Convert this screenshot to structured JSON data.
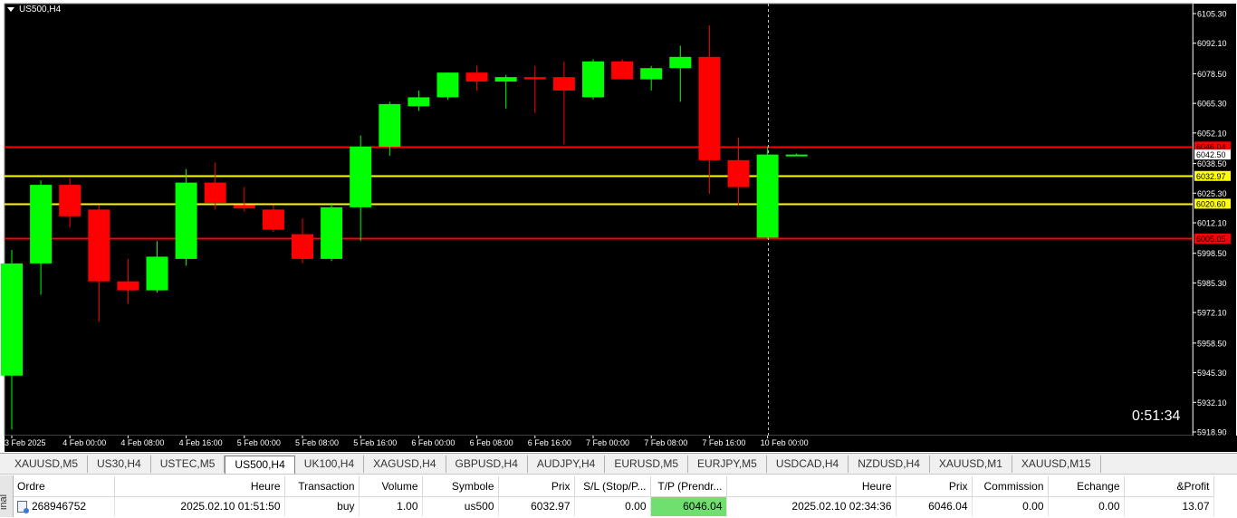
{
  "window": {
    "symbol_title": "US500,H4",
    "countdown": "0:51:34"
  },
  "colors": {
    "background": "#000000",
    "bull": "#00ff00",
    "bear": "#ff0000",
    "grid_text": "#ffffff",
    "resistance_line": "#ff0000",
    "mid_line": "#ffff00",
    "tp_highlight": "#6fe06f"
  },
  "chart_data": {
    "type": "candlestick",
    "symbol": "US500",
    "timeframe": "H4",
    "ylim": [
      5918.9,
      6105.3
    ],
    "price_ticks": [
      "6105.30",
      "6092.10",
      "6078.50",
      "6065.30",
      "6052.10",
      "6038.50",
      "6025.30",
      "6012.10",
      "5998.50",
      "5985.30",
      "5972.10",
      "5958.50",
      "5945.30",
      "5932.10",
      "5918.90"
    ],
    "time_labels": [
      {
        "i": 0,
        "label": "3 Feb 2025"
      },
      {
        "i": 2,
        "label": "4 Feb 00:00"
      },
      {
        "i": 4,
        "label": "4 Feb 08:00"
      },
      {
        "i": 6,
        "label": "4 Feb 16:00"
      },
      {
        "i": 8,
        "label": "5 Feb 00:00"
      },
      {
        "i": 10,
        "label": "5 Feb 08:00"
      },
      {
        "i": 12,
        "label": "5 Feb 16:00"
      },
      {
        "i": 14,
        "label": "6 Feb 00:00"
      },
      {
        "i": 16,
        "label": "6 Feb 08:00"
      },
      {
        "i": 18,
        "label": "6 Feb 16:00"
      },
      {
        "i": 20,
        "label": "7 Feb 00:00"
      },
      {
        "i": 22,
        "label": "7 Feb 08:00"
      },
      {
        "i": 24,
        "label": "7 Feb 16:00"
      },
      {
        "i": 26,
        "label": "10 Feb 00:00"
      }
    ],
    "candles": [
      {
        "o": 5944.0,
        "h": 6000.0,
        "l": 5920.0,
        "c": 5994.0
      },
      {
        "o": 5994.0,
        "h": 6031.0,
        "l": 5980.0,
        "c": 6029.0
      },
      {
        "o": 6029.0,
        "h": 6032.0,
        "l": 6010.0,
        "c": 6015.0
      },
      {
        "o": 6018.0,
        "h": 6020.0,
        "l": 5968.0,
        "c": 5986.0
      },
      {
        "o": 5986.0,
        "h": 5996.0,
        "l": 5976.0,
        "c": 5982.0
      },
      {
        "o": 5982.0,
        "h": 6004.0,
        "l": 5981.0,
        "c": 5997.0
      },
      {
        "o": 5996.0,
        "h": 6036.0,
        "l": 5993.0,
        "c": 6030.0
      },
      {
        "o": 6030.0,
        "h": 6039.0,
        "l": 6018.0,
        "c": 6021.0
      },
      {
        "o": 6020.0,
        "h": 6028.0,
        "l": 6017.0,
        "c": 6018.5
      },
      {
        "o": 6018.0,
        "h": 6020.0,
        "l": 6008.0,
        "c": 6009.0
      },
      {
        "o": 6007.0,
        "h": 6014.0,
        "l": 5994.0,
        "c": 5996.0
      },
      {
        "o": 5996.0,
        "h": 6021.0,
        "l": 5995.0,
        "c": 6019.0
      },
      {
        "o": 6019.0,
        "h": 6051.0,
        "l": 6004.0,
        "c": 6046.0
      },
      {
        "o": 6046.0,
        "h": 6066.0,
        "l": 6042.0,
        "c": 6065.0
      },
      {
        "o": 6064.0,
        "h": 6071.0,
        "l": 6062.0,
        "c": 6068.0
      },
      {
        "o": 6068.0,
        "h": 6079.0,
        "l": 6067.0,
        "c": 6079.0
      },
      {
        "o": 6079.0,
        "h": 6082.0,
        "l": 6071.0,
        "c": 6075.0
      },
      {
        "o": 6075.0,
        "h": 6078.0,
        "l": 6063.0,
        "c": 6077.0
      },
      {
        "o": 6077.0,
        "h": 6082.0,
        "l": 6061.0,
        "c": 6076.0
      },
      {
        "o": 6077.0,
        "h": 6084.0,
        "l": 6047.0,
        "c": 6071.0
      },
      {
        "o": 6068.0,
        "h": 6085.0,
        "l": 6067.0,
        "c": 6084.0
      },
      {
        "o": 6084.0,
        "h": 6085.0,
        "l": 6076.0,
        "c": 6076.0
      },
      {
        "o": 6076.0,
        "h": 6082.0,
        "l": 6071.0,
        "c": 6081.0
      },
      {
        "o": 6081.0,
        "h": 6091.0,
        "l": 6066.0,
        "c": 6086.0
      },
      {
        "o": 6086.0,
        "h": 6100.0,
        "l": 6025.0,
        "c": 6040.0
      },
      {
        "o": 6040.0,
        "h": 6050.0,
        "l": 6020.0,
        "c": 6028.0
      },
      {
        "o": 6005.5,
        "h": 6046.0,
        "l": 6005.0,
        "c": 6042.5
      },
      {
        "o": 6042.5,
        "h": 6043.0,
        "l": 6042.0,
        "c": 6042.5
      }
    ],
    "horizontal_lines": [
      {
        "price": 6046.04,
        "label": "6046.04",
        "color": "#ff0000",
        "label_bg": "#ff0000",
        "label_fg": "#000000"
      },
      {
        "price": 6032.97,
        "label": "6032.97",
        "color": "#ffff00",
        "label_bg": "#ffff00",
        "label_fg": "#000000"
      },
      {
        "price": 6020.6,
        "label": "6020.60",
        "color": "#ffff00",
        "label_bg": "#ffff00",
        "label_fg": "#000000"
      },
      {
        "price": 6005.05,
        "label": "6005.05",
        "color": "#ff0000",
        "label_bg": "#ff0000",
        "label_fg": "#000000"
      }
    ],
    "price_labels": [
      {
        "price": 6042.5,
        "label": "6042.50",
        "label_bg": "#ffffff",
        "label_fg": "#000000"
      }
    ],
    "crosshair_index": 26
  },
  "symbol_tabs": [
    {
      "label": "XAUUSD,M5",
      "active": false
    },
    {
      "label": "US30,H4",
      "active": false
    },
    {
      "label": "USTEC,M5",
      "active": false
    },
    {
      "label": "US500,H4",
      "active": true
    },
    {
      "label": "UK100,H4",
      "active": false
    },
    {
      "label": "XAGUSD,H4",
      "active": false
    },
    {
      "label": "GBPUSD,H4",
      "active": false
    },
    {
      "label": "AUDJPY,H4",
      "active": false
    },
    {
      "label": "EURUSD,M5",
      "active": false
    },
    {
      "label": "EURJPY,M5",
      "active": false
    },
    {
      "label": "USDCAD,H4",
      "active": false
    },
    {
      "label": "NZDUSD,H4",
      "active": false
    },
    {
      "label": "XAUUSD,M1",
      "active": false
    },
    {
      "label": "XAUUSD,M15",
      "active": false
    }
  ],
  "terminal": {
    "side_label": "inal",
    "headers": {
      "order": "Ordre",
      "time": "Heure",
      "type": "Transaction",
      "volume": "Volume",
      "symbol": "Symbole",
      "price": "Prix",
      "sl": "S/L (Stop/P...",
      "tp": "T/P (Prendr...",
      "close_time": "Heure",
      "close_price": "Prix",
      "commission": "Commission",
      "swap": "Echange",
      "profit": "&Profit"
    },
    "row": {
      "order": "268946752",
      "time": "2025.02.10 01:51:50",
      "type": "buy",
      "volume": "1.00",
      "symbol": "us500",
      "price": "6032.97",
      "sl": "0.00",
      "tp": "6046.04",
      "close_time": "2025.02.10 02:34:36",
      "close_price": "6046.04",
      "commission": "0.00",
      "swap": "0.00",
      "profit": "13.07"
    }
  }
}
